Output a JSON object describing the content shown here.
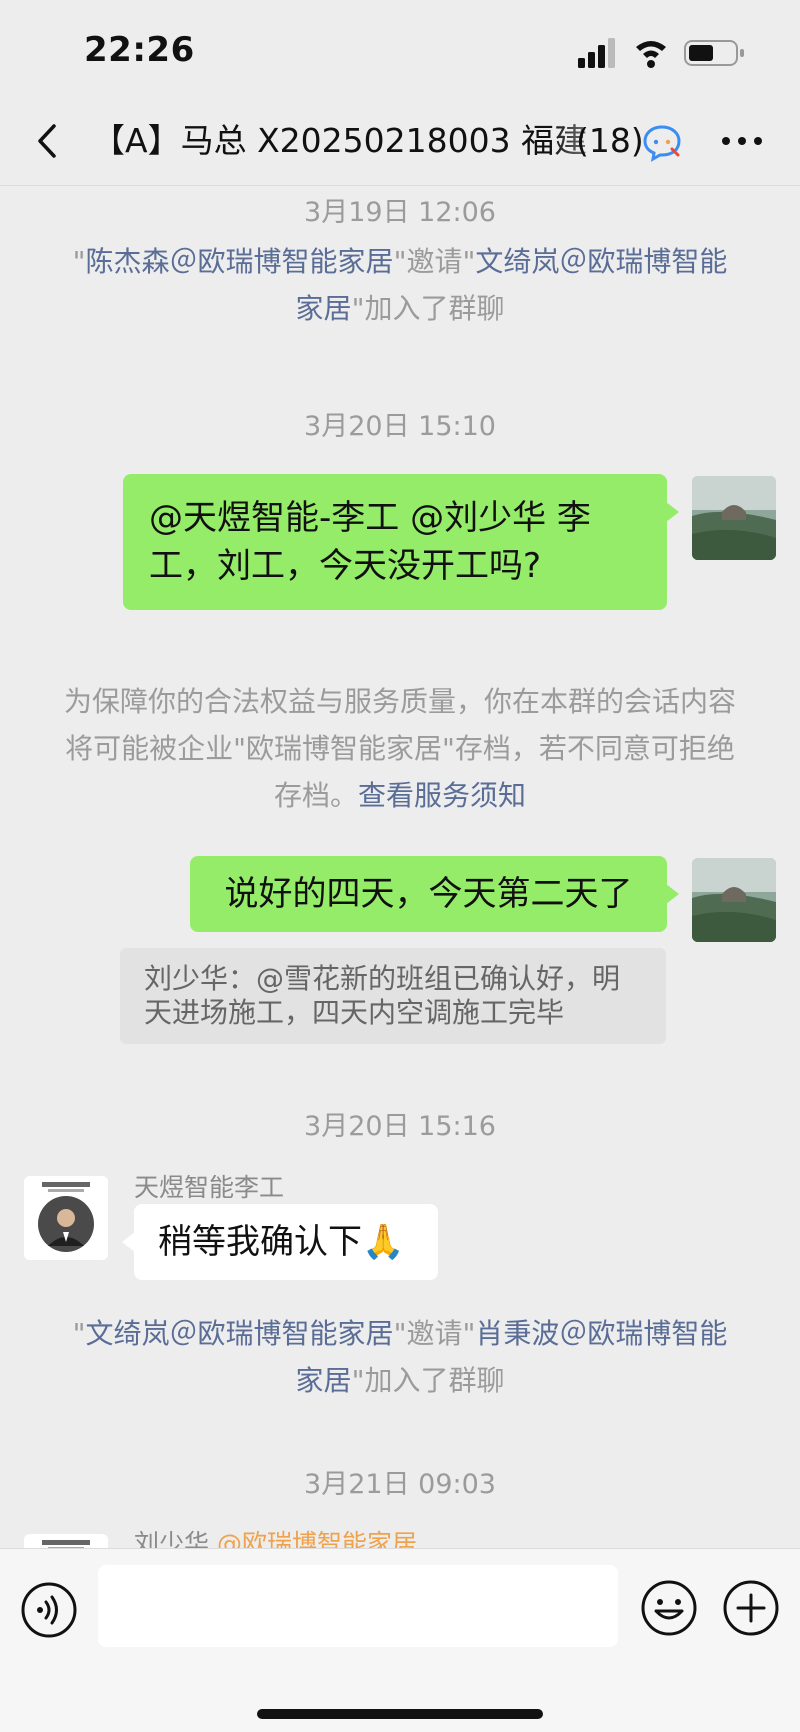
{
  "status_bar": {
    "time": "22:26"
  },
  "nav": {
    "title": "【A】马总 X20250218003 福建",
    "count": "(18)"
  },
  "messages": {
    "ts1": "3月19日 12:06",
    "sys1": {
      "q1": "\"",
      "inviter": "陈杰森＠欧瑞博智能家居",
      "q2": "\"邀请\"",
      "invitee": "文绮岚＠欧瑞博智能家居",
      "tail": "\"加入了群聊"
    },
    "ts2": "3月20日 15:10",
    "msg1": "@天煜智能-李工 @刘少华 李工，刘工，今天没开工吗?",
    "notice": {
      "text": "为保障你的合法权益与服务质量，你在本群的会话内容将可能被企业\"欧瑞博智能家居\"存档，若不同意可拒绝存档。",
      "link": "查看服务须知"
    },
    "msg2": "说好的四天，今天第二天了",
    "quote": "刘少华：@雪花新的班组已确认好，明天进场施工，四天内空调施工完毕",
    "ts3": "3月20日 15:16",
    "msg3": {
      "sender": "天煜智能李工",
      "text": "稍等我确认下",
      "emoji": "🙏"
    },
    "sys2": {
      "q1": "\"",
      "inviter": "文绮岚＠欧瑞博智能家居",
      "q2": "\"邀请\"",
      "invitee": "肖秉波＠欧瑞博智能家居",
      "tail": "\"加入了群聊"
    },
    "ts4": "3月21日 09:03",
    "msg4": {
      "sender": "刘少华",
      "org": "@欧瑞博智能家居"
    }
  },
  "input": {
    "placeholder": ""
  },
  "colors": {
    "my_bubble": "#95ec69",
    "link": "#5a6d96",
    "org_tag": "#f0a24b"
  }
}
